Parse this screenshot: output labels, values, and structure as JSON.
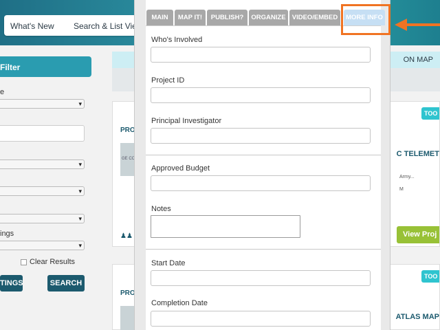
{
  "topnav": {
    "whats_new": "What's New",
    "search_list": "Search & List View"
  },
  "filter": {
    "heading": "Filter",
    "labels": [
      "e",
      "",
      "",
      "",
      "",
      "ings"
    ],
    "clear_results": "Clear Results",
    "settings_button": "TINGS",
    "search_button": "SEARCH"
  },
  "map_tab": {
    "label": "ON MAP"
  },
  "cards": [
    {
      "proj": "PRO",
      "thumb_text": "GE CO",
      "tool": "TOO",
      "title": "C TELEMET",
      "sub1": "Army...",
      "sub2": "M",
      "view": "View Proj"
    },
    {
      "proj": "PRO",
      "tool": "TOO",
      "title": "ATLAS MAP"
    }
  ],
  "modal": {
    "tabs": [
      "MAIN",
      "MAP IT!",
      "PUBLISH?",
      "ORGANIZE",
      "VIDEO/EMBED",
      "MORE INFO"
    ],
    "fields": {
      "whos_involved": "Who's Involved",
      "project_id": "Project ID",
      "principal_investigator": "Principal Investigator",
      "approved_budget": "Approved Budget",
      "notes": "Notes",
      "start_date": "Start Date",
      "completion_date": "Completion Date"
    }
  },
  "colors": {
    "accent": "#f07322",
    "active_tab": "#c6dff4",
    "tab": "#a8a8a8",
    "teal": "#2a9cb0",
    "view_btn": "#98c136"
  }
}
